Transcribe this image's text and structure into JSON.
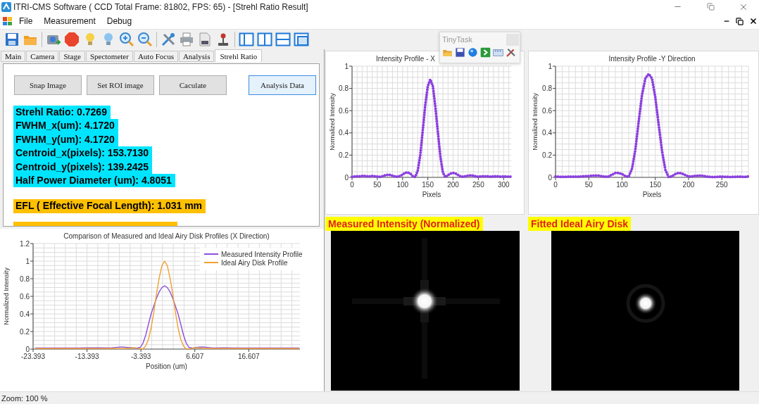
{
  "window": {
    "title": "ITRI-CMS Software ( CCD Total Frame: 81802, FPS: 65) - [Strehl Ratio Result]"
  },
  "menu": [
    {
      "label": "File"
    },
    {
      "label": "Measurement"
    },
    {
      "label": "Debug"
    }
  ],
  "tabs": [
    {
      "label": "Main",
      "selected": false
    },
    {
      "label": "Camera",
      "selected": false
    },
    {
      "label": "Stage",
      "selected": false
    },
    {
      "label": "Spectometer",
      "selected": false
    },
    {
      "label": "Auto Focus",
      "selected": false
    },
    {
      "label": "Analysis",
      "selected": false
    },
    {
      "label": "Strehl Ratio",
      "selected": true
    }
  ],
  "buttons": [
    {
      "label": "Snap Image",
      "highlighted": false
    },
    {
      "label": "Set ROI image",
      "highlighted": false
    },
    {
      "label": "Caculate",
      "highlighted": false
    },
    {
      "label": "Analysis Data",
      "highlighted": true
    }
  ],
  "results": [
    {
      "text": "Strehl Ratio: 0.7269",
      "color": "#00e5ff"
    },
    {
      "text": "FWHM_x(um): 4.1720",
      "color": "#00e5ff"
    },
    {
      "text": "FWHM_y(um): 4.1720",
      "color": "#00e5ff"
    },
    {
      "text": "Centroid_x(pixels): 153.7130",
      "color": "#00e5ff"
    },
    {
      "text": "Centroid_y(pixels): 139.2425",
      "color": "#00e5ff"
    },
    {
      "text": "Half Power Diameter (um): 4.8051",
      "color": "#00e5ff"
    },
    {
      "text": "EFL ( Effective Focal Length): 1.031 mm",
      "color": "#ffc000"
    }
  ],
  "comparison_chart": {
    "chart_data": {
      "type": "line",
      "title": "Comparison of Measured and Ideal Airy Disk Profiles (X Direction)",
      "xlabel": "Position (um)",
      "ylabel": "Normalized Intensity",
      "xlim": [
        -23.393,
        26.1
      ],
      "ylim": [
        0,
        1.2
      ],
      "xticks": [
        -23.393,
        -13.393,
        -3.393,
        6.607,
        16.607
      ],
      "yticks": [
        0,
        0.2,
        0.4,
        0.6,
        0.8,
        1,
        1.2
      ],
      "grid": true,
      "legend": true,
      "x": [
        -23,
        -21,
        -19,
        -17,
        -15,
        -13,
        -11,
        -9,
        -7,
        -5,
        -4.5,
        -4,
        -3.5,
        -3,
        -2.5,
        -2,
        -1.5,
        -1,
        -0.5,
        0,
        0.5,
        1,
        1.5,
        2,
        2.5,
        3,
        3.5,
        4,
        4.5,
        5,
        5.5,
        6,
        6.5,
        7,
        8,
        10,
        12,
        14,
        16,
        18,
        20,
        22,
        24,
        26
      ],
      "series": [
        {
          "name": "Measured Intensity Profile",
          "color": "#8a4fe0",
          "values": [
            0.012,
            0.012,
            0.012,
            0.012,
            0.012,
            0.015,
            0.014,
            0.012,
            0.025,
            0.015,
            0.012,
            0.012,
            0.02,
            0.07,
            0.16,
            0.28,
            0.4,
            0.49,
            0.58,
            0.65,
            0.7,
            0.72,
            0.7,
            0.65,
            0.58,
            0.49,
            0.4,
            0.28,
            0.16,
            0.07,
            0.02,
            0.012,
            0.014,
            0.02,
            0.025,
            0.012,
            0.014,
            0.012,
            0.012,
            0.012,
            0.012,
            0.012,
            0.012,
            0.012
          ]
        },
        {
          "name": "Ideal Airy Disk Profile",
          "color": "#f0a030",
          "values": [
            0.006,
            0.006,
            0.006,
            0.006,
            0.006,
            0.006,
            0.006,
            0.006,
            0.006,
            0.012,
            0.015,
            0.007,
            0.004,
            0.004,
            0.035,
            0.11,
            0.24,
            0.42,
            0.63,
            0.81,
            0.95,
            1.0,
            0.95,
            0.81,
            0.63,
            0.42,
            0.24,
            0.11,
            0.035,
            0.004,
            0.004,
            0.007,
            0.015,
            0.017,
            0.01,
            0.006,
            0.006,
            0.006,
            0.006,
            0.006,
            0.006,
            0.006,
            0.006,
            0.006
          ]
        }
      ]
    }
  },
  "x_profile": {
    "chart_data": {
      "type": "line",
      "title": "Intensity Profile - X",
      "xlabel": "Pixels",
      "ylabel": "Normalized Intensity",
      "xlim": [
        0,
        315
      ],
      "ylim": [
        0,
        1
      ],
      "xticks": [
        0,
        50,
        100,
        150,
        200,
        250,
        300
      ],
      "yticks": [
        0,
        0.2,
        0.4,
        0.6,
        0.8,
        1
      ],
      "grid": true,
      "x": [
        0,
        5,
        10,
        15,
        20,
        25,
        30,
        35,
        40,
        45,
        50,
        55,
        60,
        65,
        70,
        75,
        80,
        85,
        90,
        95,
        100,
        105,
        110,
        115,
        120,
        125,
        130,
        135,
        140,
        145,
        150,
        155,
        160,
        165,
        170,
        175,
        180,
        185,
        190,
        195,
        200,
        205,
        210,
        215,
        220,
        225,
        230,
        235,
        240,
        245,
        250,
        255,
        260,
        265,
        270,
        275,
        280,
        285,
        290,
        295,
        300,
        305,
        310,
        315
      ],
      "series": [
        {
          "color": "#8b3fe0",
          "line_style": "dotted",
          "values": [
            0.005,
            0.008,
            0.01,
            0.01,
            0.012,
            0.012,
            0.01,
            0.01,
            0.012,
            0.01,
            0.008,
            0.005,
            0.01,
            0.018,
            0.022,
            0.022,
            0.015,
            0.008,
            0.005,
            0.012,
            0.025,
            0.04,
            0.045,
            0.035,
            0.012,
            0.003,
            0.06,
            0.2,
            0.42,
            0.65,
            0.82,
            0.88,
            0.82,
            0.63,
            0.4,
            0.18,
            0.04,
            0.003,
            0.02,
            0.035,
            0.04,
            0.035,
            0.02,
            0.008,
            0.005,
            0.01,
            0.015,
            0.018,
            0.015,
            0.01,
            0.005,
            0.008,
            0.01,
            0.01,
            0.008,
            0.006,
            0.008,
            0.01,
            0.008,
            0.006,
            0.008,
            0.008,
            0.006,
            0.006
          ]
        }
      ]
    }
  },
  "y_profile": {
    "chart_data": {
      "type": "line",
      "title": "Intensity Profile -Y Direction",
      "xlabel": "Pixels",
      "ylabel": "Normalized Intensity",
      "xlim": [
        0,
        290
      ],
      "ylim": [
        0,
        1
      ],
      "xticks": [
        0,
        50,
        100,
        150,
        200,
        250
      ],
      "yticks": [
        0,
        0.2,
        0.4,
        0.6,
        0.8,
        1
      ],
      "grid": true,
      "x": [
        0,
        5,
        10,
        15,
        20,
        25,
        30,
        35,
        40,
        45,
        50,
        55,
        60,
        65,
        70,
        75,
        80,
        85,
        90,
        95,
        100,
        105,
        110,
        115,
        120,
        125,
        130,
        135,
        140,
        145,
        150,
        155,
        160,
        165,
        170,
        175,
        180,
        185,
        190,
        195,
        200,
        205,
        210,
        215,
        220,
        225,
        230,
        235,
        240,
        245,
        250,
        255,
        260,
        265,
        270,
        275,
        280,
        285,
        290
      ],
      "series": [
        {
          "color": "#8b3fe0",
          "line_style": "dotted",
          "values": [
            0.008,
            0.006,
            0.005,
            0.005,
            0.006,
            0.006,
            0.006,
            0.007,
            0.008,
            0.01,
            0.012,
            0.015,
            0.016,
            0.015,
            0.01,
            0.005,
            0.008,
            0.025,
            0.04,
            0.04,
            0.03,
            0.01,
            0.005,
            0.08,
            0.25,
            0.5,
            0.74,
            0.89,
            0.93,
            0.89,
            0.72,
            0.48,
            0.24,
            0.07,
            0.004,
            0.01,
            0.03,
            0.04,
            0.035,
            0.02,
            0.008,
            0.008,
            0.013,
            0.016,
            0.014,
            0.01,
            0.005,
            0.003,
            0.004,
            0.006,
            0.006,
            0.005,
            0.004,
            0.004,
            0.005,
            0.006,
            0.006,
            0.005,
            0.008
          ]
        }
      ]
    }
  },
  "images": [
    {
      "label": "Measured Intensity (Normalized)",
      "kind": "picture"
    },
    {
      "label": "Fitted Ideal Airy Disk",
      "kind": "picture"
    }
  ],
  "tinytask": {
    "title": "TinyTask"
  },
  "status_bar": "Zoom: 100 %"
}
